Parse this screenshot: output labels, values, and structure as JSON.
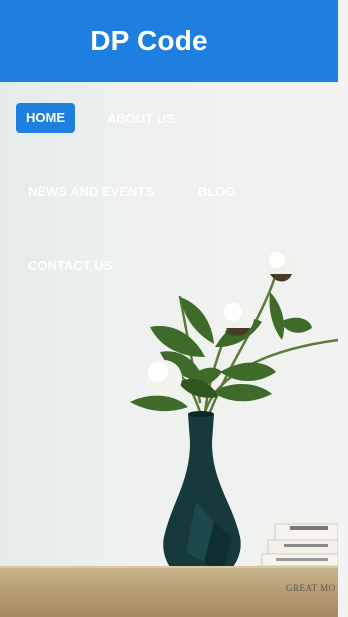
{
  "header": {
    "title": "DP Code",
    "background": "#1e7fe0"
  },
  "nav": {
    "items": [
      {
        "label": "HOME",
        "active": true
      },
      {
        "label": "ABOUT US",
        "active": false
      },
      {
        "label": "NEWS AND EVENTS",
        "active": false
      },
      {
        "label": "BLOG",
        "active": false
      },
      {
        "label": "CONTACT US",
        "active": false
      }
    ]
  },
  "hero": {
    "book_labels": [
      "GREAT MO"
    ]
  },
  "colors": {
    "accent": "#1e7fe0",
    "nav_text": "#ffffff",
    "vase": "#163a3c",
    "leaves": "#3f6b2a",
    "flowers": "#f3f3ee"
  }
}
